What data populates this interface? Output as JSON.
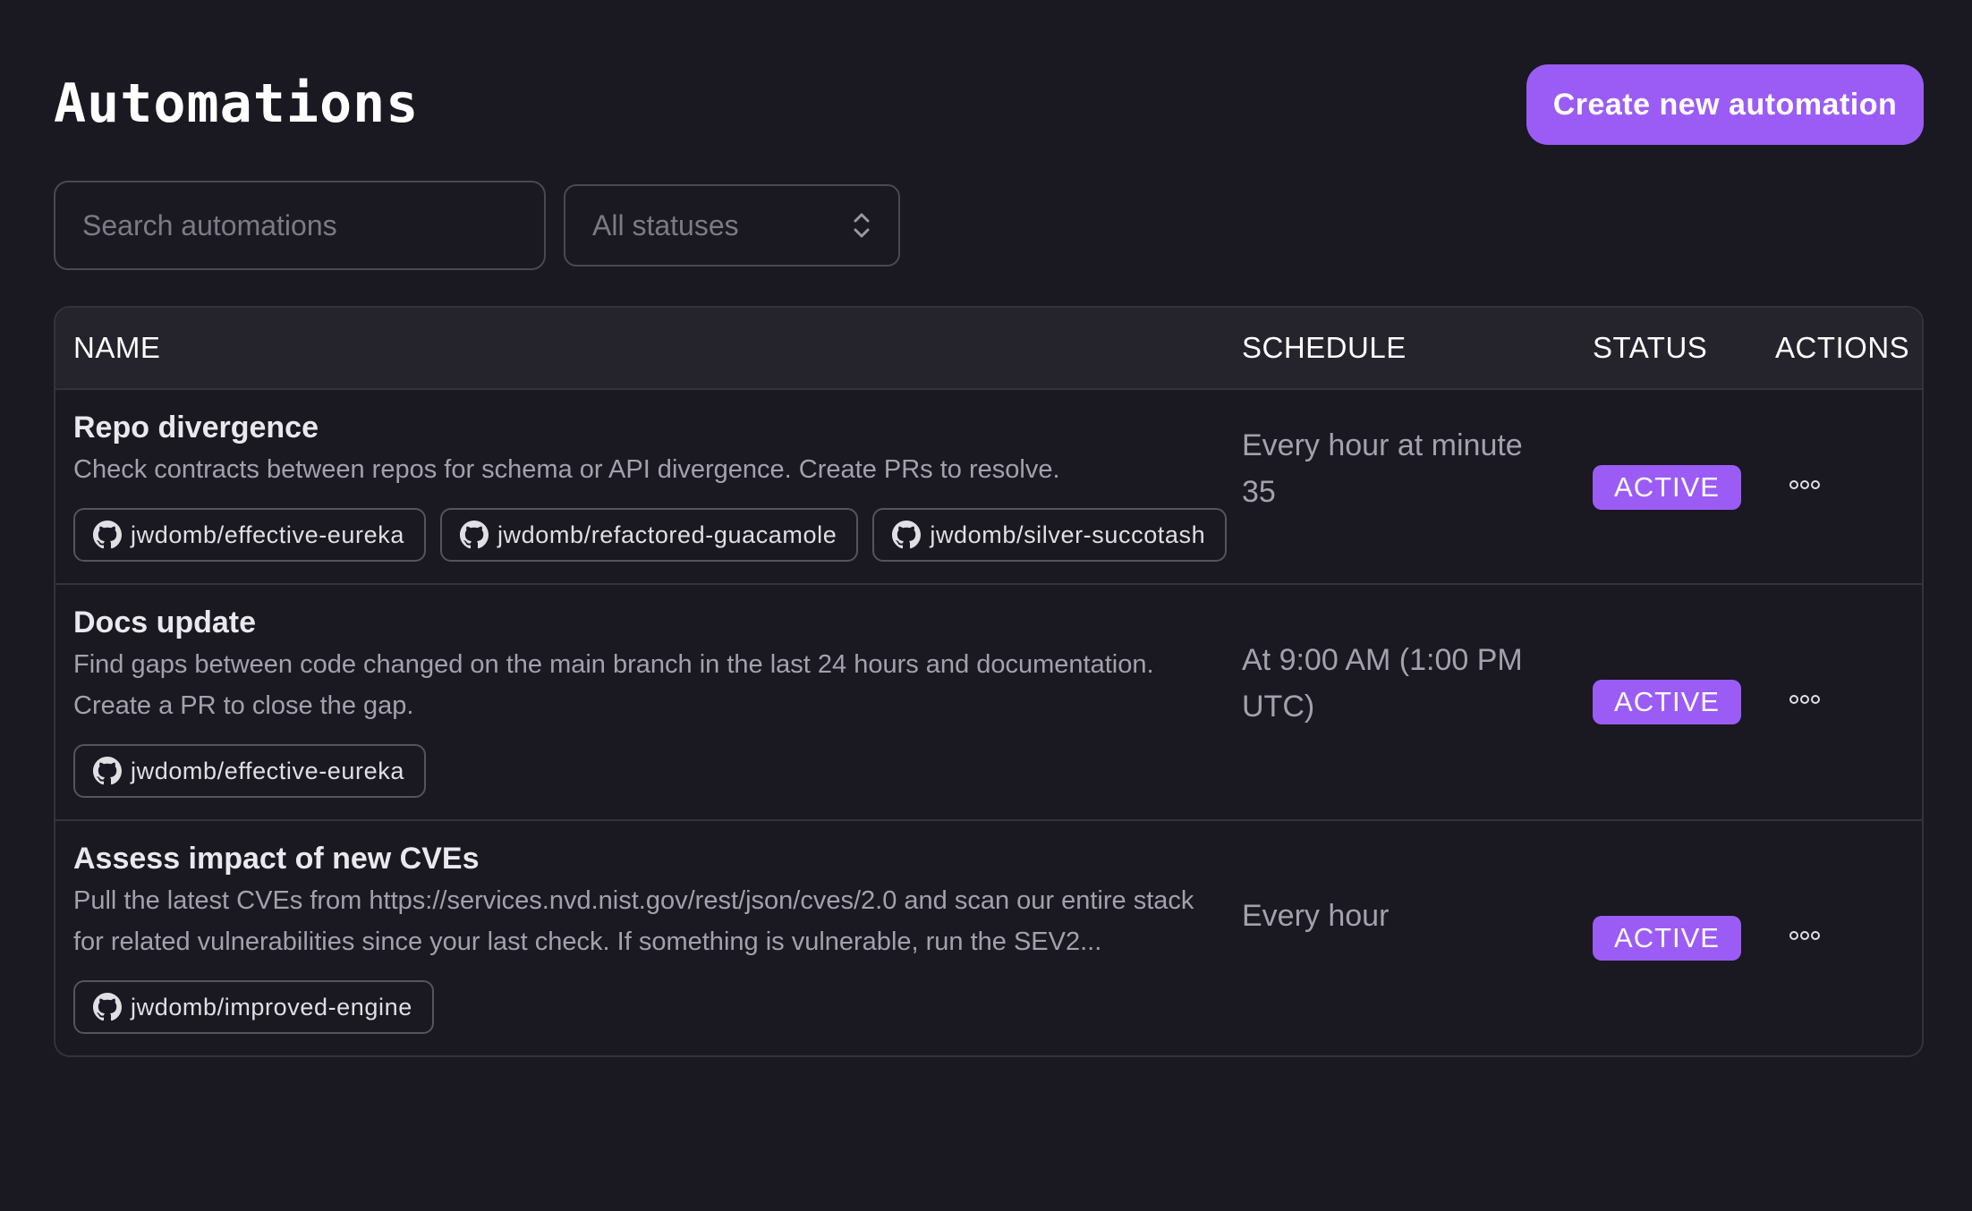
{
  "header": {
    "title": "Automations",
    "create_button_label": "Create new automation"
  },
  "filters": {
    "search_placeholder": "Search automations",
    "search_value": "",
    "status_selected": "All statuses"
  },
  "table": {
    "columns": {
      "name": "NAME",
      "schedule": "SCHEDULE",
      "status": "STATUS",
      "actions": "ACTIONS"
    },
    "rows": [
      {
        "title": "Repo divergence",
        "description": "Check contracts between repos for schema or API divergence. Create PRs to resolve.",
        "repos": [
          "jwdomb/effective-eureka",
          "jwdomb/refactored-guacamole",
          "jwdomb/silver-succotash"
        ],
        "schedule": "Every hour at minute 35",
        "status": "ACTIVE"
      },
      {
        "title": "Docs update",
        "description": "Find gaps between code changed on the main branch in the last 24 hours and documentation. Create a PR to close the gap.",
        "repos": [
          "jwdomb/effective-eureka"
        ],
        "schedule": "At 9:00 AM (1:00 PM UTC)",
        "status": "ACTIVE"
      },
      {
        "title": "Assess impact of new CVEs",
        "description": "Pull the latest CVEs from https://services.nvd.nist.gov/rest/json/cves/2.0 and scan our entire stack for related vulnerabilities since your last check. If something is vulnerable, run the SEV2...",
        "repos": [
          "jwdomb/improved-engine"
        ],
        "schedule": "Every hour",
        "status": "ACTIVE"
      }
    ]
  },
  "icons": {
    "repo": "github-icon",
    "actions": "more-icon",
    "select": "chevrons-up-down-icon"
  },
  "colors": {
    "background": "#1a1820",
    "accent": "#9b5cf5",
    "header_row": "#25232b",
    "border": "#34323c",
    "muted_text": "#a3a1ad"
  }
}
